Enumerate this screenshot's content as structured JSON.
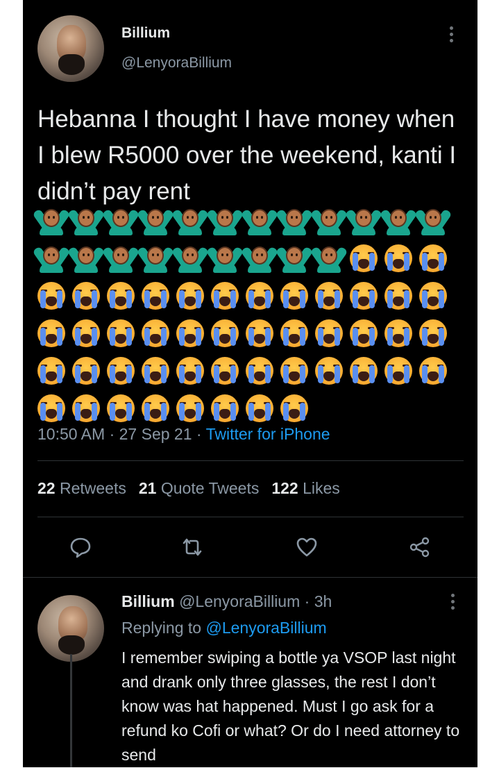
{
  "tweet": {
    "author_name": "Billium",
    "author_handle": "@LenyoraBillium",
    "text": "Hebanna I thought I have money when I blew R5000 over the weekend, kanti I didn’t pay rent",
    "emoji_rows": [
      [
        "person-gesturing-no",
        "person-gesturing-no",
        "person-gesturing-no",
        "person-gesturing-no",
        "person-gesturing-no",
        "person-gesturing-no",
        "person-gesturing-no",
        "person-gesturing-no",
        "person-gesturing-no",
        "person-gesturing-no",
        "person-gesturing-no",
        "person-gesturing-no"
      ],
      [
        "person-gesturing-no",
        "person-gesturing-no",
        "person-gesturing-no",
        "person-gesturing-no",
        "person-gesturing-no",
        "person-gesturing-no",
        "person-gesturing-no",
        "person-gesturing-no",
        "person-gesturing-no",
        "loudly-crying-face",
        "loudly-crying-face",
        "loudly-crying-face"
      ],
      [
        "loudly-crying-face",
        "loudly-crying-face",
        "loudly-crying-face",
        "loudly-crying-face",
        "loudly-crying-face",
        "loudly-crying-face",
        "loudly-crying-face",
        "loudly-crying-face",
        "loudly-crying-face",
        "loudly-crying-face",
        "loudly-crying-face",
        "loudly-crying-face"
      ],
      [
        "loudly-crying-face",
        "loudly-crying-face",
        "loudly-crying-face",
        "loudly-crying-face",
        "loudly-crying-face",
        "loudly-crying-face",
        "loudly-crying-face",
        "loudly-crying-face",
        "loudly-crying-face",
        "loudly-crying-face",
        "loudly-crying-face",
        "loudly-crying-face"
      ],
      [
        "loudly-crying-face",
        "loudly-crying-face",
        "loudly-crying-face",
        "loudly-crying-face",
        "loudly-crying-face",
        "loudly-crying-face",
        "loudly-crying-face",
        "loudly-crying-face",
        "loudly-crying-face",
        "loudly-crying-face",
        "loudly-crying-face",
        "loudly-crying-face"
      ],
      [
        "loudly-crying-face",
        "loudly-crying-face",
        "loudly-crying-face",
        "loudly-crying-face",
        "loudly-crying-face",
        "loudly-crying-face",
        "loudly-crying-face",
        "loudly-crying-face"
      ]
    ],
    "time": "10:50 AM",
    "date": "27 Sep 21",
    "source": "Twitter for iPhone",
    "separator": "·"
  },
  "stats": {
    "retweets_count": "22",
    "retweets_label": "Retweets",
    "quotes_count": "21",
    "quotes_label": "Quote Tweets",
    "likes_count": "122",
    "likes_label": "Likes"
  },
  "actions": [
    "reply-icon",
    "retweet-icon",
    "like-icon",
    "share-icon"
  ],
  "reply": {
    "author_name": "Billium",
    "author_handle": "@LenyoraBillium",
    "age": "3h",
    "replying_prefix": "Replying to",
    "replying_handle": "@LenyoraBillium",
    "text": "I remember swiping a bottle ya VSOP last night and drank only three glasses, the rest I don’t know was hat happened. Must I go ask for a refund ko Cofi or what? Or do I need attorney to send"
  },
  "colors": {
    "background": "#000000",
    "text": "#e7e9ea",
    "secondary": "#8b98a5",
    "link": "#1d9bf0",
    "divider": "#2f3336"
  }
}
